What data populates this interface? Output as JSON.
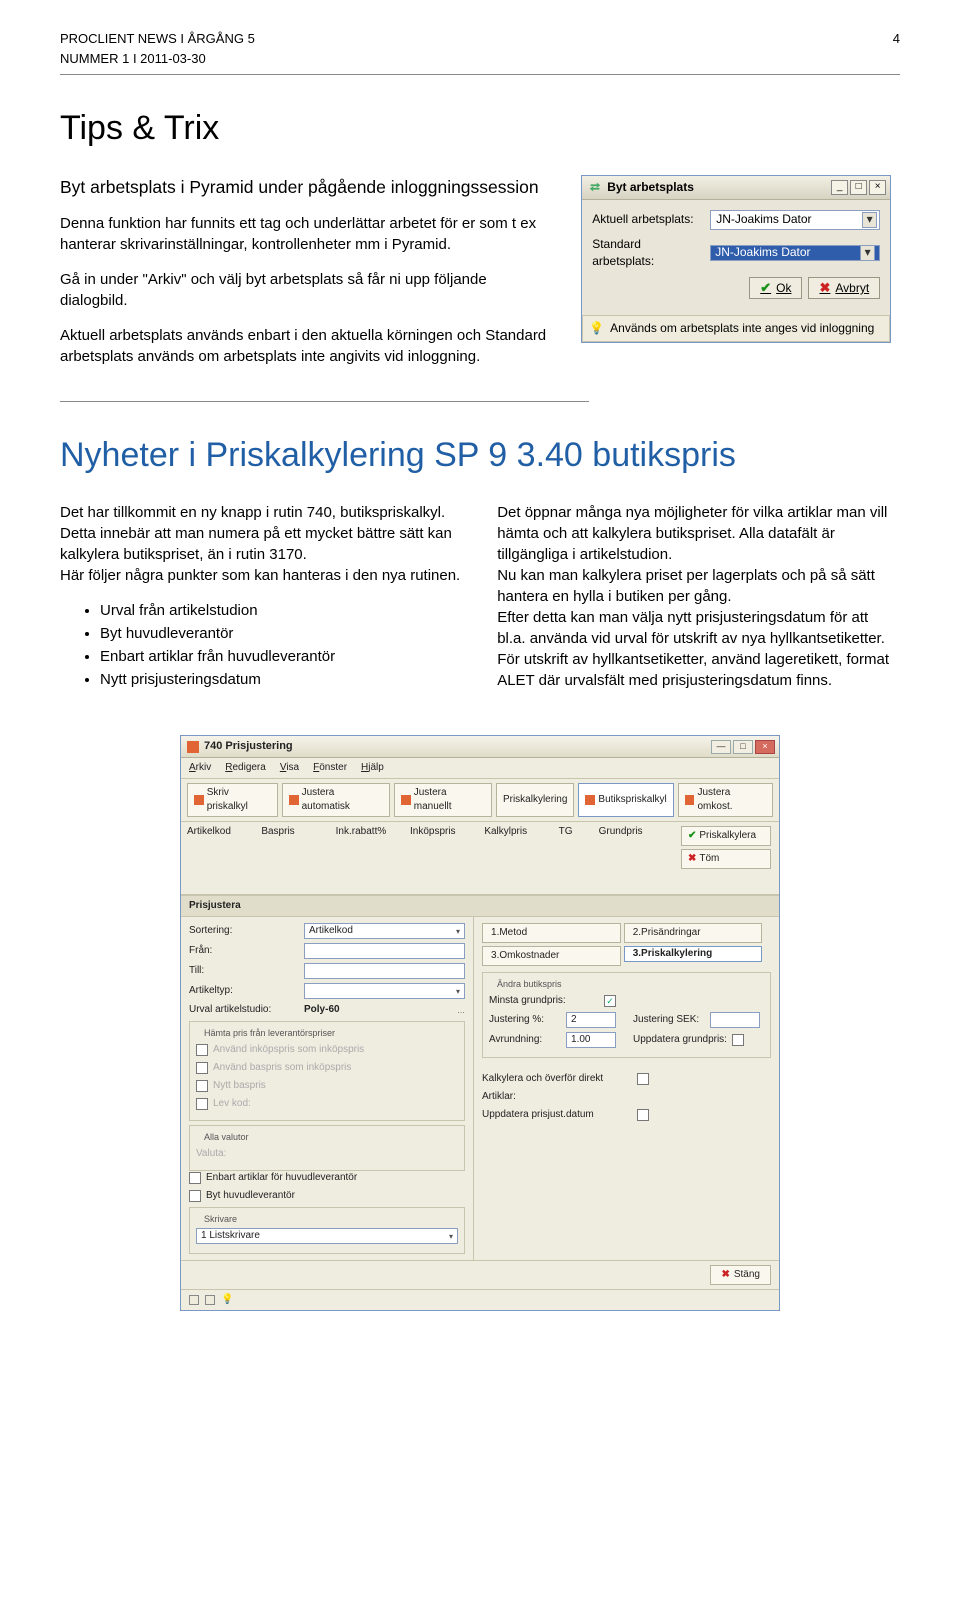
{
  "header": {
    "left_top": "PROCLIENT NEWS  I  ÅRGÅNG 5",
    "left_bottom": "NUMMER 1  I  2011-03-30",
    "page_num": "4"
  },
  "section1": {
    "title": "Tips & Trix",
    "subtitle": "Byt arbetsplats i Pyramid under pågående inloggningssession",
    "p1": "Denna funktion har funnits ett tag och underlättar arbetet för er som t ex hanterar skrivarinställningar, kontrollenheter mm i Pyramid.",
    "p2": "Gå in under \"Arkiv\" och välj byt arbetsplats så får ni upp följande dialogbild.",
    "p3": "Aktuell arbetsplats används enbart i den aktuella körningen och Standard arbetsplats används om arbetsplats inte angivits vid inloggning."
  },
  "dialog": {
    "title": "Byt arbetsplats",
    "l_current": "Aktuell arbetsplats:",
    "l_standard": "Standard arbetsplats:",
    "v_current": "JN-Joakims Dator",
    "v_standard": "JN-Joakims Dator",
    "ok": "Ok",
    "cancel": "Avbryt",
    "status": "Används om arbetsplats inte anges vid inloggning"
  },
  "section2": {
    "title": "Nyheter i Priskalkylering SP 9 3.40 butikspris",
    "left_p1": "Det har tillkommit en ny knapp i rutin 740, butikspriskalkyl.",
    "left_p2": "Detta innebär att man numera på ett mycket bättre sätt kan kalkylera butikspriset, än i rutin 3170.",
    "left_p3": "Här följer några punkter som kan hanteras i den nya rutinen.",
    "bullets": [
      "Urval från artikelstudion",
      "Byt huvudleverantör",
      "Enbart artiklar från huvudleverantör",
      "Nytt prisjusteringsdatum"
    ],
    "right_p": "Det öppnar många nya möjligheter för vilka artiklar man vill hämta och att kalkylera butikspriset. Alla datafält är tillgängliga i artikelstudion.\nNu kan man kalkylera priset per lagerplats och på så sätt hantera en hylla i butiken per gång.\nEfter detta kan man välja nytt prisjusteringsdatum för att bl.a. använda vid urval för utskrift av nya hyllkantsetiketter.\nFör utskrift av hyllkantsetiketter, använd lageretikett, format ALET där urvalsfält med prisjusteringsdatum finns."
  },
  "appwin": {
    "title": "740 Prisjustering",
    "menu": [
      "Arkiv",
      "Redigera",
      "Visa",
      "Fönster",
      "Hjälp"
    ],
    "toolbar": [
      "Skriv priskalkyl",
      "Justera automatisk",
      "Justera manuellt",
      "Priskalkylering",
      "Butikspriskalkyl",
      "Justera omkost."
    ],
    "cols": [
      "Artikelkod",
      "Baspris",
      "Ink.rabatt%",
      "Inköpspris",
      "Kalkylpris",
      "TG",
      "Grundpris"
    ],
    "side": {
      "a": "Priskalkylera",
      "b": "Töm"
    },
    "panel_title": "Prisjustera",
    "left": {
      "l_sort": "Sortering:",
      "v_sort": "Artikelkod",
      "l_from": "Från:",
      "l_to": "Till:",
      "l_type": "Artikeltyp:",
      "l_urval": "Urval artikelstudio:",
      "v_urval": "Poly-60",
      "grp1_title": "Hämta pris från leverantörspriser",
      "cb1": "Använd inköpspris som inköpspris",
      "cb2": "Använd baspris som inköpspris",
      "cb3": "Nytt baspris",
      "cb4": "Lev kod:",
      "grp2_title": "Alla valutor",
      "cb5": "Valuta:",
      "cb6": "Enbart artiklar för huvudleverantör",
      "cb7": "Byt huvudleverantör",
      "grp3_title": "Skrivare",
      "printer": "1 Listskrivare"
    },
    "right": {
      "tab1": "1.Metod",
      "tab2": "2.Prisändringar",
      "tab3": "3.Omkostnader",
      "tab4": "3.Priskalkylering",
      "grp_title": "Ändra butikspris",
      "l_minsta": "Minsta grundpris:",
      "l_just_pct": "Justering %:",
      "v_just_pct": "2",
      "l_just_sek": "Justering SEK:",
      "l_round": "Avrundning:",
      "v_round": "1.00",
      "l_upd_gp": "Uppdatera grundpris:",
      "l_kalk": "Kalkylera och överför direkt",
      "l_art": "Artiklar:",
      "l_upddate": "Uppdatera prisjust.datum"
    },
    "close": "Stäng"
  }
}
